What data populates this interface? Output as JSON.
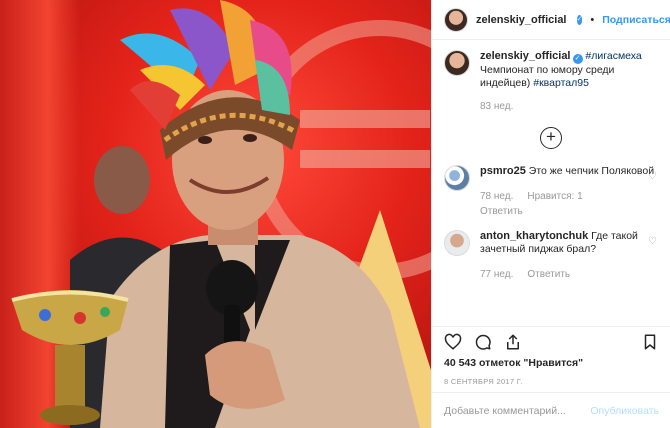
{
  "header": {
    "username": "zelenskiy_official",
    "separator": "•",
    "follow_label": "Подписаться"
  },
  "caption": {
    "username": "zelenskiy_official",
    "tag1": "#лигасмеха",
    "text": "Чемпионат по юмору среди индейцев)",
    "tag2": "#квартал95",
    "age": "83 нед."
  },
  "comments": [
    {
      "username": "psmro25",
      "text": "Это же чепчик Поляковой",
      "age": "78 нед.",
      "likes": "Нравится: 1",
      "reply": "Ответить"
    },
    {
      "username": "anton_kharytonchuk",
      "text": "Где такой зачетный пиджак брал?",
      "age": "77 нед.",
      "reply": "Ответить"
    }
  ],
  "actions": {
    "likes_text": "40 543 отметок \"Нравится\"",
    "date": "8 СЕНТЯБРЯ 2017 Г."
  },
  "add_comment": {
    "placeholder": "Добавьте комментарий...",
    "publish_label": "Опубликовать"
  },
  "colors": {
    "accent": "#3897f0",
    "hashtag": "#003569",
    "muted": "#999999",
    "border": "#efefef"
  }
}
